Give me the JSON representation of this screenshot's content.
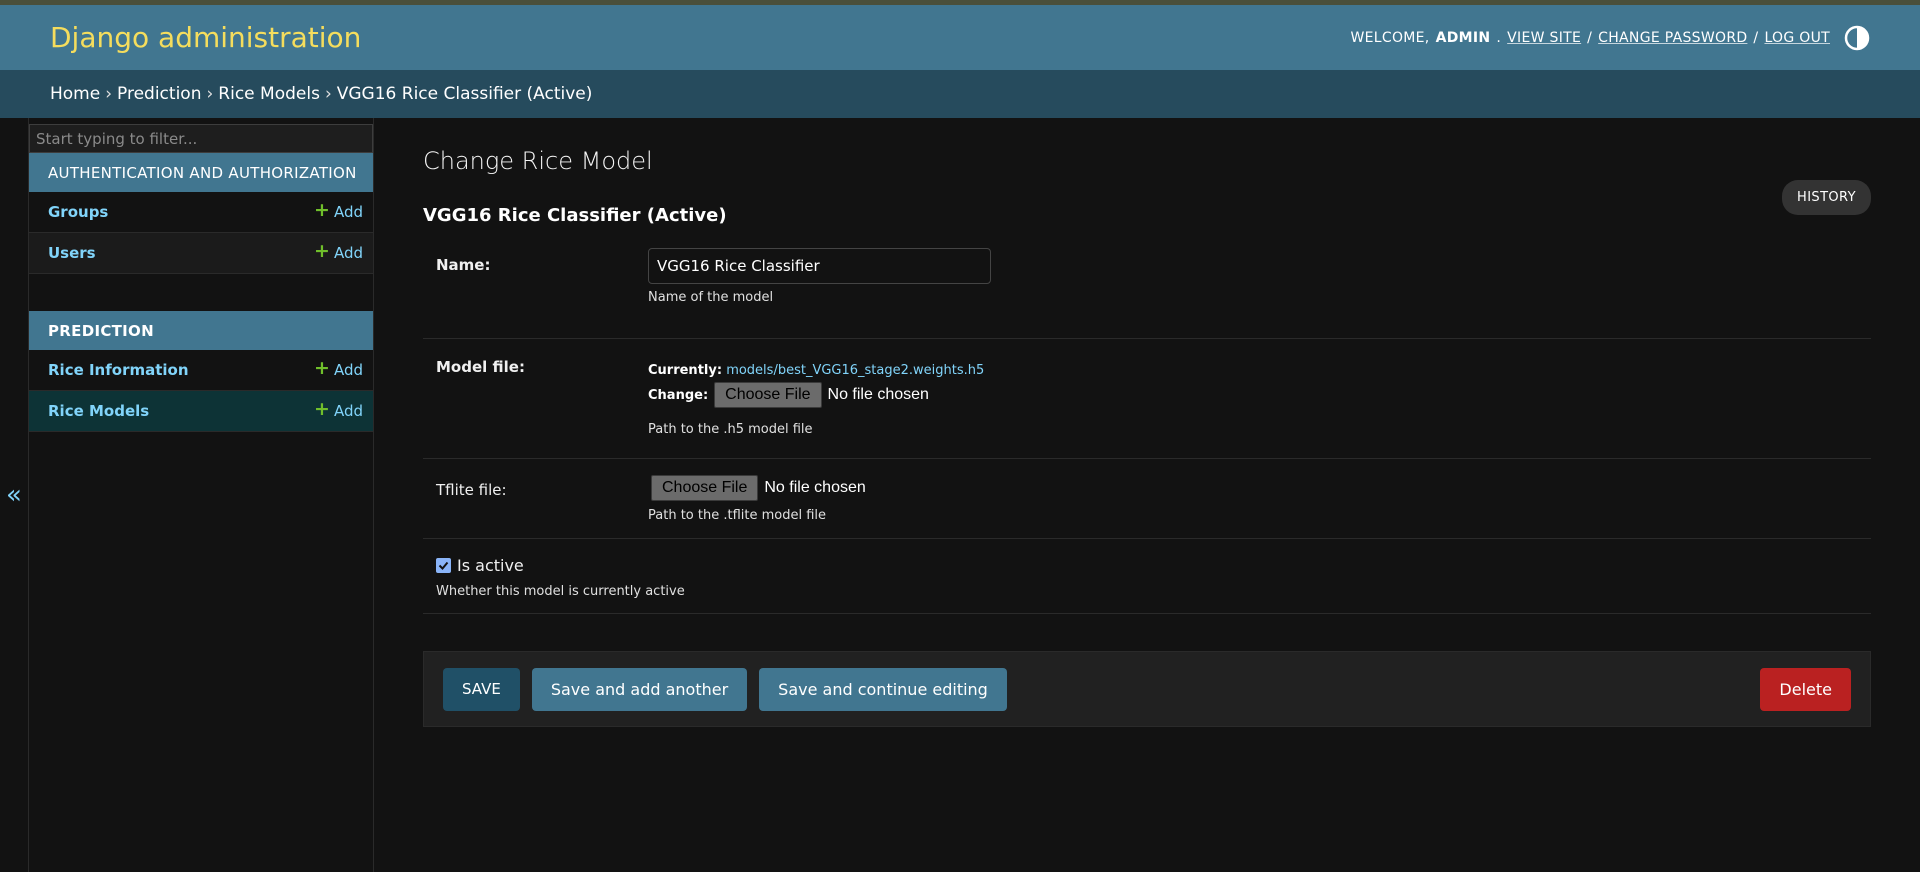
{
  "header": {
    "branding": "Django administration",
    "welcome_prefix": "WELCOME,",
    "username": "ADMIN",
    "view_site": "VIEW SITE",
    "change_password": "CHANGE PASSWORD",
    "log_out": "LOG OUT",
    "sep": "/"
  },
  "breadcrumbs": [
    "Home",
    "Prediction",
    "Rice Models",
    "VGG16 Rice Classifier (Active)"
  ],
  "sidebar": {
    "toggle_icon": "«",
    "filter_placeholder": "Start typing to filter...",
    "modules": [
      {
        "caption": "AUTHENTICATION AND AUTHORIZATION",
        "models": [
          {
            "name": "Groups",
            "add": "Add"
          },
          {
            "name": "Users",
            "add": "Add"
          }
        ]
      },
      {
        "caption": "PREDICTION",
        "models": [
          {
            "name": "Rice Information",
            "add": "Add"
          },
          {
            "name": "Rice Models",
            "add": "Add"
          }
        ]
      }
    ]
  },
  "content": {
    "title": "Change Rice Model",
    "history": "HISTORY",
    "object_title": "VGG16 Rice Classifier (Active)",
    "fields": {
      "name": {
        "label": "Name:",
        "value": "VGG16 Rice Classifier",
        "help": "Name of the model"
      },
      "model_file": {
        "label": "Model file:",
        "currently_label": "Currently:",
        "currently_value": "models/best_VGG16_stage2.weights.h5",
        "change_label": "Change:",
        "choose": "Choose File",
        "no_file": "No file chosen",
        "help": "Path to the .h5 model file"
      },
      "tflite_file": {
        "label": "Tflite file:",
        "choose": "Choose File",
        "no_file": "No file chosen",
        "help": "Path to the .tflite model file"
      },
      "is_active": {
        "label": "Is active",
        "checked": true,
        "help": "Whether this model is currently active"
      }
    },
    "submit": {
      "save": "SAVE",
      "save_add": "Save and add another",
      "save_continue": "Save and continue editing",
      "delete": "Delete"
    }
  },
  "colors": {
    "header_bg": "#417690",
    "breadcrumbs_bg": "#264b5d",
    "branding": "#f5dd5d",
    "link": "#81d4fa",
    "add_plus": "#70bf2b",
    "delete": "#ba2121"
  }
}
